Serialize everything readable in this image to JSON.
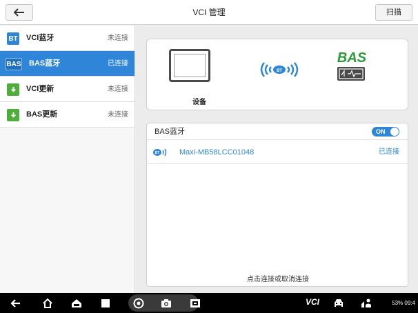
{
  "header": {
    "title": "VCI 管理",
    "scan_label": "扫描"
  },
  "sidebar": {
    "items": [
      {
        "icon_text": "BT",
        "label": "VCI蓝牙",
        "status": "未连接",
        "active": false
      },
      {
        "icon_text": "BAS",
        "label": "BAS蓝牙",
        "status": "已连接",
        "active": true
      },
      {
        "icon_text": "",
        "label": "VCI更新",
        "status": "未连接",
        "active": false
      },
      {
        "icon_text": "",
        "label": "BAS更新",
        "status": "未连接",
        "active": false
      }
    ]
  },
  "device_card": {
    "device_label": "设备",
    "bas_logo_text": "BAS"
  },
  "bas_panel": {
    "title": "BAS蓝牙",
    "toggle_label": "ON",
    "devices": [
      {
        "name": "Maxi-MB58LCC01048",
        "status": "已连接"
      }
    ],
    "hint": "点击连接或取消连接"
  },
  "taskbar": {
    "vci_label": "VCI",
    "status_text": "53% 09:4"
  },
  "colors": {
    "accent": "#2f86d8",
    "bas_green": "#2e9a3b",
    "download_green": "#4fae3b"
  }
}
